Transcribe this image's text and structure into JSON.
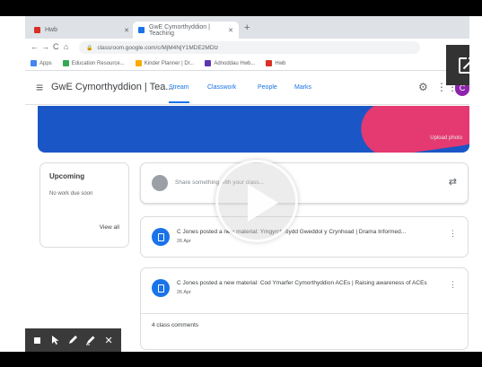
{
  "browser": {
    "tabs": [
      {
        "label": "Hwb"
      },
      {
        "label": "GwE Cymorthyddion | Teaching"
      }
    ],
    "new_tab": "+",
    "nav": {
      "back": "←",
      "forward": "→",
      "reload": "C",
      "home": "⌂"
    },
    "address": "classroom.google.com/c/MjM4NjY1MDE2MDlz",
    "bookmarks": [
      {
        "label": "Apps"
      },
      {
        "label": "Education Resource..."
      },
      {
        "label": "Kinder Planner | Dr..."
      },
      {
        "label": "Adnoddau Hwb..."
      },
      {
        "label": "Hwb"
      }
    ]
  },
  "classroom": {
    "class_name": "GwE Cymorthyddion | Tea...",
    "tabs": [
      {
        "label": "Stream"
      },
      {
        "label": "Classwork"
      },
      {
        "label": "People"
      },
      {
        "label": "Marks"
      }
    ],
    "avatar_letter": "C",
    "upload_photo": "Upload photo",
    "upcoming": {
      "heading": "Upcoming",
      "status": "No work due soon",
      "view_all": "View all"
    },
    "share_placeholder": "Share something with your class...",
    "posts": [
      {
        "title": "C Jones posted a new material: Ymgyrch Sydd Gweddol y Crynhoad | Drama Informed...",
        "date": "26 Apr"
      },
      {
        "title": "C Jones posted a new material: Cod Ymarfer Cymorthyddion ACEs | Raising awareness of ACEs",
        "date": "26 Apr",
        "comments": "4 class comments"
      }
    ]
  },
  "icons": {
    "play": "play-icon",
    "popout": "open-in-new-icon",
    "toolbar": [
      "stop-icon",
      "pointer-icon",
      "pen-icon",
      "highlighter-icon",
      "close-icon"
    ]
  },
  "colors": {
    "accent": "#1a73e8",
    "banner": "#1a56c6",
    "banner_shape": "#e53971",
    "avatar": "#8e24aa"
  }
}
